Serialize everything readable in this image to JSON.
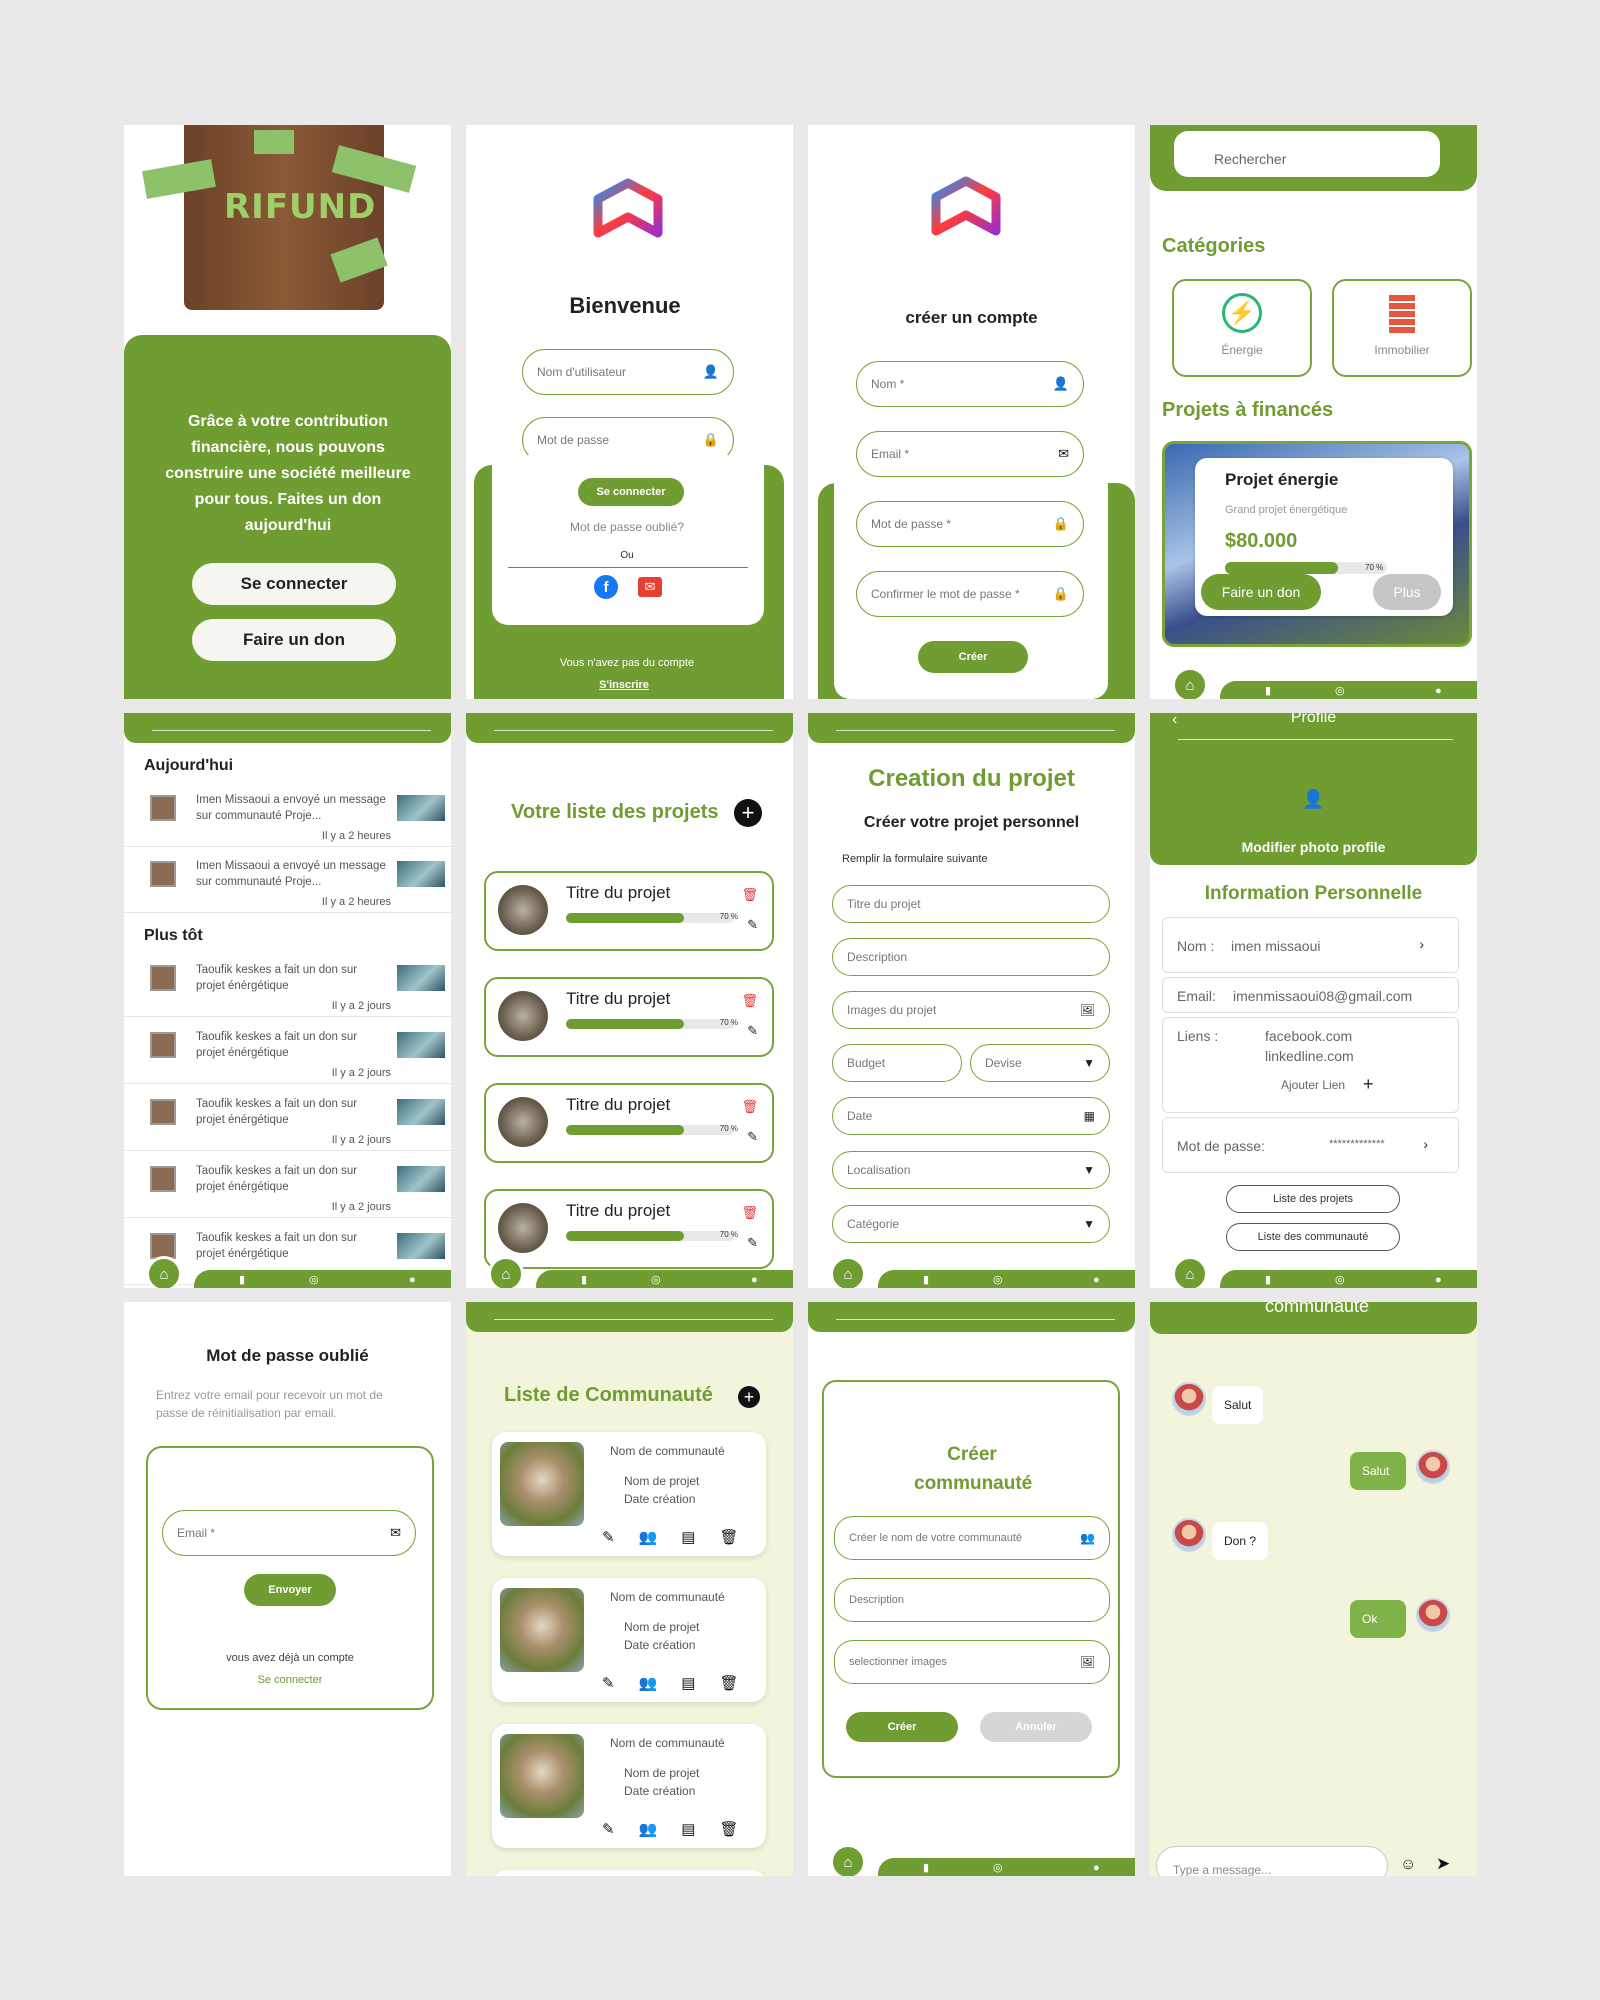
{
  "p1": {
    "heading": "RIFUND",
    "text": "Grâce à votre contribution financière, nous pouvons construire une société meilleure pour tous. Faites un don aujourd'hui",
    "login": "Se connecter",
    "donate": "Faire un don"
  },
  "p2": {
    "title": "Bienvenue",
    "user_ph": "Nom d'utilisateur",
    "pass_ph": "Mot de passe",
    "login": "Se connecter",
    "forgot": "Mot de passe oublié?",
    "or": "Ou",
    "no_account": "Vous n'avez pas du compte",
    "signup": "S'inscrire"
  },
  "p3": {
    "title": "créer un compte",
    "name": "Nom *",
    "email": "Email *",
    "pass": "Mot de passe *",
    "confirm": "Confirmer le mot de passe *",
    "create": "Créer"
  },
  "p4": {
    "search": "Rechercher",
    "categories_title": "Catégories",
    "cat1": "Énergie",
    "cat2": "Immobilier",
    "funded_title": "Projets à financés",
    "card_title": "Projet énergie",
    "card_sub": "Grand projet énergétique",
    "card_amount": "$80.000",
    "card_pct": "70 %",
    "card_progress": 0.7,
    "donate": "Faire un don",
    "more": "Plus"
  },
  "p5": {
    "today": "Aujourd'hui",
    "earlier": "Plus tôt",
    "n1": "Imen Missaoui a envoyé un message sur  communauté Proje...",
    "n1_time": "Il y a 2 heures",
    "n2": "Imen Missaoui a envoyé un message sur  communauté Proje...",
    "n2_time": "Il y a 2 heures",
    "d": "Taoufik keskes a fait un don sur projet énérgétique",
    "d_time": "Il y a 2 jours"
  },
  "p6": {
    "title": "Votre liste des projets",
    "item": "Titre du projet",
    "pct": "70 %",
    "progress": 0.7
  },
  "p7": {
    "title": "Creation du projet",
    "subtitle": "Créer votre projet personnel",
    "hint": "Remplir la formulaire suivante",
    "f1": "Titre du projet",
    "f2": "Description",
    "f3": "Images du projet",
    "f4": "Budget",
    "f5": "Devise",
    "f6": "Date",
    "f7": "Localisation",
    "f8": "Catégorie"
  },
  "p8": {
    "header": "Profile",
    "edit_photo": "Modifier photo profile",
    "section": "Information Personnelle",
    "name_label": "Nom :",
    "name_value": "imen missaoui",
    "email_label": "Email:",
    "email_value": "imenmissaoui08@gmail.com",
    "links_label": "Liens :",
    "link1": "facebook.com",
    "link2": "linkedline.com",
    "add_link": "Ajouter Lien",
    "pass_label": "Mot de passe:",
    "pass_value": "*************",
    "btn_projects": "Liste des projets",
    "btn_comm": "Liste des communauté"
  },
  "p9": {
    "title": "Mot de passe oublié",
    "text": "Entrez votre email pour recevoir un mot de passe de réinitialisation par email.",
    "email": "Email *",
    "send": "Envoyer",
    "have_account": "vous avez déjà un compte",
    "login": "Se connecter"
  },
  "p10": {
    "title": "Liste de Communauté",
    "name": "Nom de communauté",
    "project": "Nom de projet",
    "date": "Date création"
  },
  "p11": {
    "title": "Créer communauté",
    "f1": "Créer le nom de votre communauté",
    "f2": "Description",
    "f3": "selectionner images",
    "create": "Créer",
    "cancel": "Annuler"
  },
  "p12": {
    "header": "communauté",
    "m1": "Salut",
    "m2": "Salut",
    "m3": "Don ?",
    "m4": "Ok",
    "input_ph": "Type a message..."
  },
  "colors": {
    "accent": "#6f9d31",
    "chat_bg": "#f2f4dc"
  }
}
